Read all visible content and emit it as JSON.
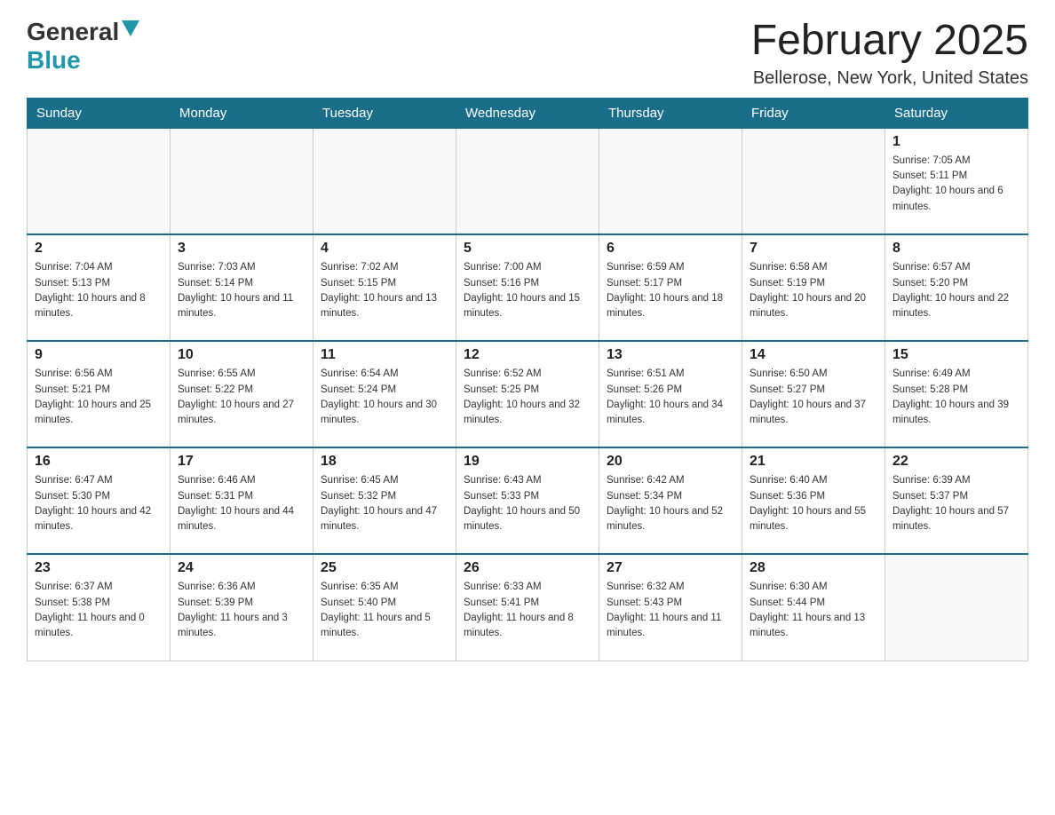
{
  "header": {
    "logo_general": "General",
    "logo_blue": "Blue",
    "month": "February 2025",
    "location": "Bellerose, New York, United States"
  },
  "days_of_week": [
    "Sunday",
    "Monday",
    "Tuesday",
    "Wednesday",
    "Thursday",
    "Friday",
    "Saturday"
  ],
  "weeks": [
    [
      {
        "day": "",
        "info": ""
      },
      {
        "day": "",
        "info": ""
      },
      {
        "day": "",
        "info": ""
      },
      {
        "day": "",
        "info": ""
      },
      {
        "day": "",
        "info": ""
      },
      {
        "day": "",
        "info": ""
      },
      {
        "day": "1",
        "info": "Sunrise: 7:05 AM\nSunset: 5:11 PM\nDaylight: 10 hours and 6 minutes."
      }
    ],
    [
      {
        "day": "2",
        "info": "Sunrise: 7:04 AM\nSunset: 5:13 PM\nDaylight: 10 hours and 8 minutes."
      },
      {
        "day": "3",
        "info": "Sunrise: 7:03 AM\nSunset: 5:14 PM\nDaylight: 10 hours and 11 minutes."
      },
      {
        "day": "4",
        "info": "Sunrise: 7:02 AM\nSunset: 5:15 PM\nDaylight: 10 hours and 13 minutes."
      },
      {
        "day": "5",
        "info": "Sunrise: 7:00 AM\nSunset: 5:16 PM\nDaylight: 10 hours and 15 minutes."
      },
      {
        "day": "6",
        "info": "Sunrise: 6:59 AM\nSunset: 5:17 PM\nDaylight: 10 hours and 18 minutes."
      },
      {
        "day": "7",
        "info": "Sunrise: 6:58 AM\nSunset: 5:19 PM\nDaylight: 10 hours and 20 minutes."
      },
      {
        "day": "8",
        "info": "Sunrise: 6:57 AM\nSunset: 5:20 PM\nDaylight: 10 hours and 22 minutes."
      }
    ],
    [
      {
        "day": "9",
        "info": "Sunrise: 6:56 AM\nSunset: 5:21 PM\nDaylight: 10 hours and 25 minutes."
      },
      {
        "day": "10",
        "info": "Sunrise: 6:55 AM\nSunset: 5:22 PM\nDaylight: 10 hours and 27 minutes."
      },
      {
        "day": "11",
        "info": "Sunrise: 6:54 AM\nSunset: 5:24 PM\nDaylight: 10 hours and 30 minutes."
      },
      {
        "day": "12",
        "info": "Sunrise: 6:52 AM\nSunset: 5:25 PM\nDaylight: 10 hours and 32 minutes."
      },
      {
        "day": "13",
        "info": "Sunrise: 6:51 AM\nSunset: 5:26 PM\nDaylight: 10 hours and 34 minutes."
      },
      {
        "day": "14",
        "info": "Sunrise: 6:50 AM\nSunset: 5:27 PM\nDaylight: 10 hours and 37 minutes."
      },
      {
        "day": "15",
        "info": "Sunrise: 6:49 AM\nSunset: 5:28 PM\nDaylight: 10 hours and 39 minutes."
      }
    ],
    [
      {
        "day": "16",
        "info": "Sunrise: 6:47 AM\nSunset: 5:30 PM\nDaylight: 10 hours and 42 minutes."
      },
      {
        "day": "17",
        "info": "Sunrise: 6:46 AM\nSunset: 5:31 PM\nDaylight: 10 hours and 44 minutes."
      },
      {
        "day": "18",
        "info": "Sunrise: 6:45 AM\nSunset: 5:32 PM\nDaylight: 10 hours and 47 minutes."
      },
      {
        "day": "19",
        "info": "Sunrise: 6:43 AM\nSunset: 5:33 PM\nDaylight: 10 hours and 50 minutes."
      },
      {
        "day": "20",
        "info": "Sunrise: 6:42 AM\nSunset: 5:34 PM\nDaylight: 10 hours and 52 minutes."
      },
      {
        "day": "21",
        "info": "Sunrise: 6:40 AM\nSunset: 5:36 PM\nDaylight: 10 hours and 55 minutes."
      },
      {
        "day": "22",
        "info": "Sunrise: 6:39 AM\nSunset: 5:37 PM\nDaylight: 10 hours and 57 minutes."
      }
    ],
    [
      {
        "day": "23",
        "info": "Sunrise: 6:37 AM\nSunset: 5:38 PM\nDaylight: 11 hours and 0 minutes."
      },
      {
        "day": "24",
        "info": "Sunrise: 6:36 AM\nSunset: 5:39 PM\nDaylight: 11 hours and 3 minutes."
      },
      {
        "day": "25",
        "info": "Sunrise: 6:35 AM\nSunset: 5:40 PM\nDaylight: 11 hours and 5 minutes."
      },
      {
        "day": "26",
        "info": "Sunrise: 6:33 AM\nSunset: 5:41 PM\nDaylight: 11 hours and 8 minutes."
      },
      {
        "day": "27",
        "info": "Sunrise: 6:32 AM\nSunset: 5:43 PM\nDaylight: 11 hours and 11 minutes."
      },
      {
        "day": "28",
        "info": "Sunrise: 6:30 AM\nSunset: 5:44 PM\nDaylight: 11 hours and 13 minutes."
      },
      {
        "day": "",
        "info": ""
      }
    ]
  ]
}
